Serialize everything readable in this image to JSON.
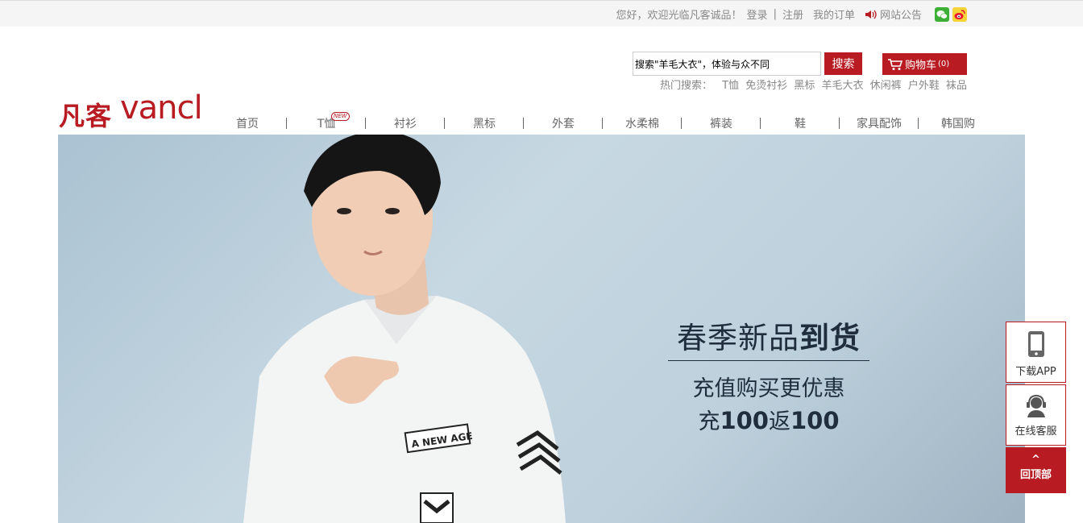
{
  "topbar": {
    "greeting": "您好，欢迎光临凡客诚品！",
    "login": "登录",
    "separator": "|",
    "register": "注册",
    "my_orders": "我的订单",
    "announcement": "网站公告",
    "icons": [
      "speaker-icon",
      "wechat-icon",
      "weibo-icon"
    ]
  },
  "logo": {
    "cn": "凡客",
    "en": "vancl",
    "color": "#b81c22"
  },
  "search": {
    "value": "搜索\"羊毛大衣\"，体验与众不同",
    "button": "搜索"
  },
  "cart": {
    "label": "购物车",
    "count": "(0)"
  },
  "hot": {
    "label": "热门搜索：",
    "items": [
      "T恤",
      "免烫衬衫",
      "黑标",
      "羊毛大衣",
      "休闲裤",
      "户外鞋",
      "袜品"
    ]
  },
  "nav": {
    "items": [
      "首页",
      "T恤",
      "衬衫",
      "黑标",
      "外套",
      "水柔棉",
      "裤装",
      "鞋",
      "家具配饰",
      "韩国购"
    ],
    "new_badge": "NEW"
  },
  "banner": {
    "headline_normal": "春季新品",
    "headline_bold": "到货",
    "line2": "充值购买更优惠",
    "line3_a": "充",
    "line3_b": "100",
    "line3_c": "返",
    "line3_d": "100",
    "shirt_patch": "A NEW AGE"
  },
  "side": {
    "download": "下载APP",
    "service": "在线客服",
    "top_arrow": "^",
    "back_top": "回顶部"
  },
  "colors": {
    "brand": "#b81c22",
    "banner_bg": "#bdd0dc"
  }
}
